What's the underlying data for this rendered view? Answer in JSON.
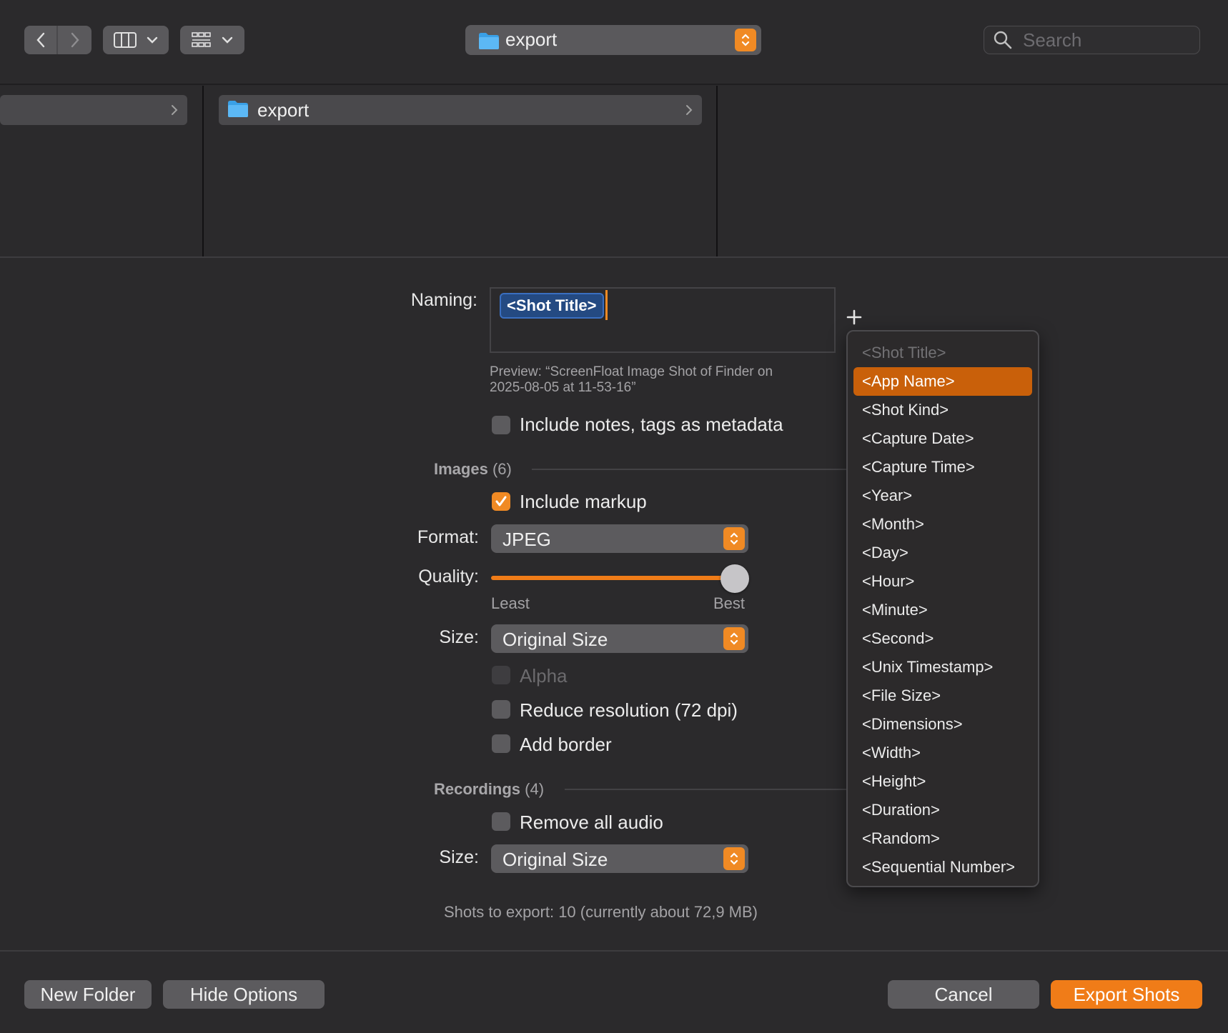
{
  "toolbar": {
    "location": "export",
    "search_placeholder": "Search"
  },
  "browser": {
    "column2_folder": "export"
  },
  "naming": {
    "label": "Naming:",
    "token": "<Shot Title>",
    "preview_line1": "Preview: “ScreenFloat Image Shot of Finder on",
    "preview_line2": "2025-08-05 at 11-53-16”",
    "include_metadata_label": "Include notes, tags as metadata",
    "include_metadata_checked": false
  },
  "images": {
    "section_label": "Images",
    "count": "(6)",
    "include_markup_label": "Include markup",
    "include_markup_checked": true,
    "format_label": "Format:",
    "format_value": "JPEG",
    "quality_label": "Quality:",
    "quality_value": 1.0,
    "quality_min_label": "Least",
    "quality_max_label": "Best",
    "size_label": "Size:",
    "size_value": "Original Size",
    "alpha_label": "Alpha",
    "reduce_resolution_label": "Reduce resolution (72 dpi)",
    "add_border_label": "Add border"
  },
  "recordings": {
    "section_label": "Recordings",
    "count": "(4)",
    "remove_audio_label": "Remove all audio",
    "size_label": "Size:",
    "size_value": "Original Size"
  },
  "summary": "Shots to export: 10 (currently about 72,9 MB)",
  "token_menu": {
    "items": [
      "<Shot Title>",
      "<App Name>",
      "<Shot Kind>",
      "<Capture Date>",
      "<Capture Time>",
      "<Year>",
      "<Month>",
      "<Day>",
      "<Hour>",
      "<Minute>",
      "<Second>",
      "<Unix Timestamp>",
      "<File Size>",
      "<Dimensions>",
      "<Width>",
      "<Height>",
      "<Duration>",
      "<Random>",
      "<Sequential Number>"
    ],
    "disabled_item": "<Shot Title>",
    "highlighted_item": "<App Name>"
  },
  "buttons": {
    "new_folder": "New Folder",
    "hide_options": "Hide Options",
    "cancel": "Cancel",
    "export": "Export Shots"
  },
  "colors": {
    "accent": "#f08a24",
    "highlight": "#c9600a",
    "token_bg": "#244a82",
    "background": "#2b2a2c"
  }
}
